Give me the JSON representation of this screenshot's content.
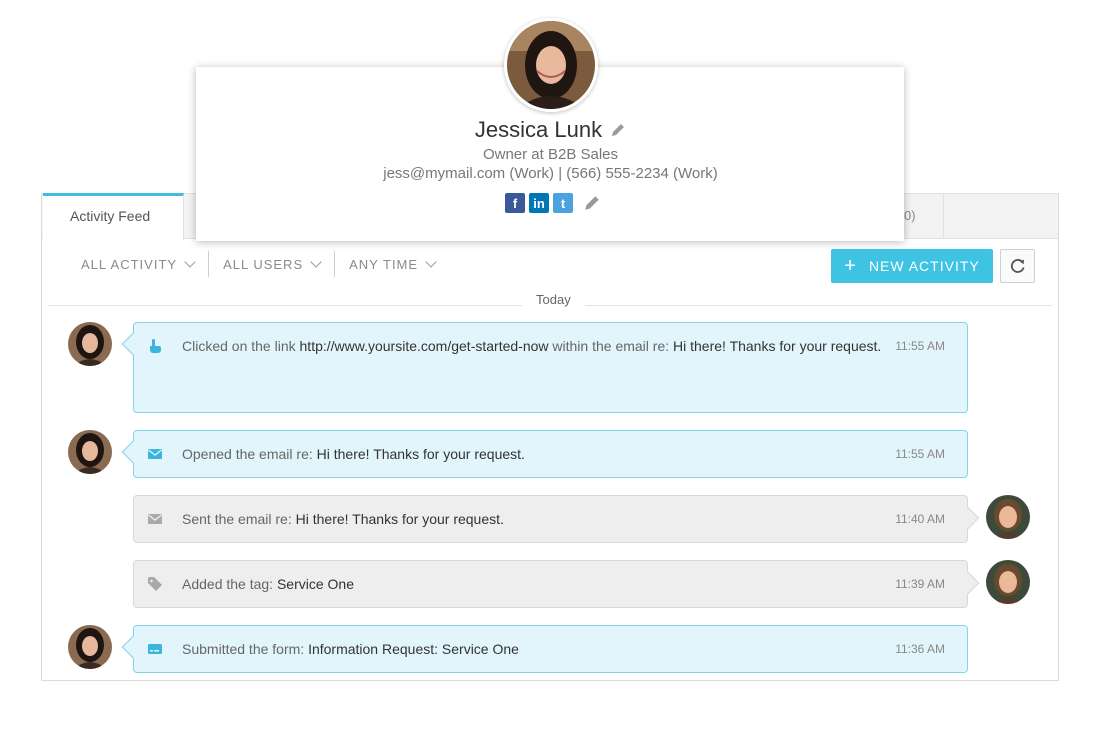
{
  "contact": {
    "name": "Jessica Lunk",
    "title": "Owner at B2B Sales",
    "details": "jess@mymail.com (Work) | (566) 555-2234 (Work)",
    "socials": [
      {
        "icon": "facebook-icon",
        "glyph": "f",
        "color": "#3b5998"
      },
      {
        "icon": "linkedin-icon",
        "glyph": "in",
        "color": "#0077b5"
      },
      {
        "icon": "twitter-icon",
        "glyph": "t",
        "color": "#4aa3df"
      }
    ]
  },
  "tabs": {
    "active": "Activity Feed",
    "partial": "0)"
  },
  "filters": [
    {
      "label": "ALL ACTIVITY"
    },
    {
      "label": "ALL USERS"
    },
    {
      "label": "ANY TIME"
    }
  ],
  "toolbar": {
    "new_activity_plus": "+",
    "new_activity_label": "NEW ACTIVITY",
    "refresh_icon": "refresh-icon"
  },
  "feed": {
    "day_label": "Today",
    "items": [
      {
        "type": "link-click",
        "icon": "pointer-hand-icon",
        "style": "blue",
        "side": "left",
        "prefix": "Clicked on the link ",
        "link": "http://www.yoursite.com/get-started-now",
        "middle": " within the email re: ",
        "subject": "Hi there! Thanks for your request.",
        "time": "11:55 AM"
      },
      {
        "type": "email-open",
        "icon": "envelope-icon",
        "style": "blue",
        "side": "left",
        "prefix": "Opened the email re: ",
        "subject": "Hi there! Thanks for your request.",
        "time": "11:55 AM"
      },
      {
        "type": "email-sent",
        "icon": "envelope-icon",
        "style": "gray",
        "side": "right",
        "prefix": "Sent the email re: ",
        "subject": "Hi there! Thanks for your request.",
        "time": "11:40 AM"
      },
      {
        "type": "tag-added",
        "icon": "tag-icon",
        "style": "gray",
        "side": "right",
        "prefix": "Added the tag: ",
        "subject": "Service One",
        "time": "11:39 AM"
      },
      {
        "type": "form-submitted",
        "icon": "form-card-icon",
        "style": "blue",
        "side": "left",
        "prefix": "Submitted the form: ",
        "subject": "Information Request: Service One",
        "time": "11:36 AM"
      }
    ]
  },
  "colors": {
    "accent": "#3ec3e3",
    "blue_item_bg": "#e3f5fc",
    "gray_item_bg": "#eeeeee"
  }
}
